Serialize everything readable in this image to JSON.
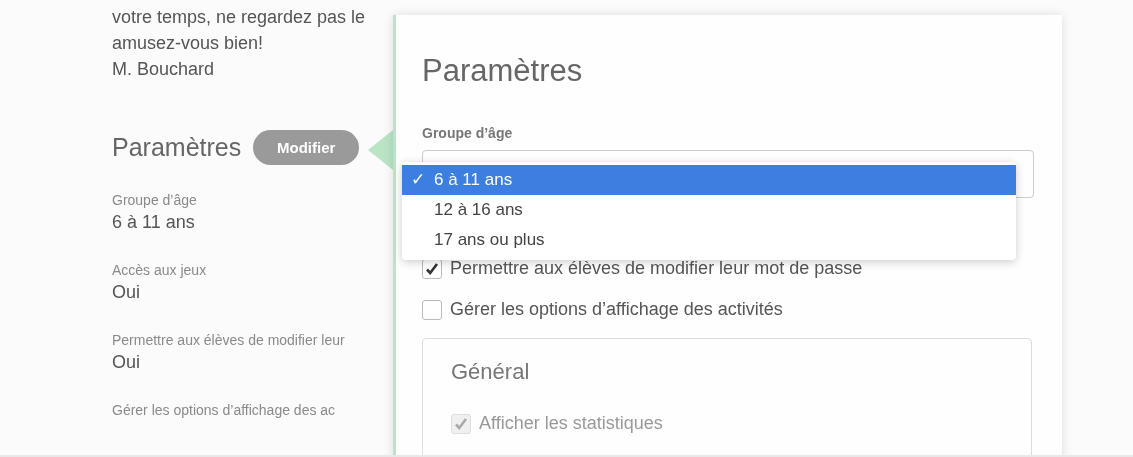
{
  "message": {
    "lines": [
      "votre temps, ne regardez pas le",
      "amusez-vous bien!",
      "M. Bouchard"
    ]
  },
  "summary": {
    "title": "Paramètres",
    "edit_button": "Modifier",
    "fields": [
      {
        "label": "Groupe d’âge",
        "value": "6 à 11 ans"
      },
      {
        "label": "Accès aux jeux",
        "value": "Oui"
      },
      {
        "label": "Permettre aux élèves de modifier leur",
        "value": "Oui"
      },
      {
        "label": "Gérer les options d’affichage des ac"
      }
    ]
  },
  "panel": {
    "title": "Paramètres",
    "age_group": {
      "label": "Groupe d’âge",
      "check": "✓",
      "options": [
        {
          "label": "6 à 11 ans",
          "selected": true
        },
        {
          "label": "12 à 16 ans",
          "selected": false
        },
        {
          "label": "17 ans ou plus",
          "selected": false
        }
      ]
    },
    "checkboxes": [
      {
        "label": "Permettre aux élèves de modifier leur mot de passe",
        "checked": true
      },
      {
        "label": "Gérer les options d’affichage des activités",
        "checked": false
      }
    ],
    "section": {
      "title": "Général",
      "checkboxes": [
        {
          "label": "Afficher les statistiques",
          "checked": true,
          "disabled": true
        }
      ]
    }
  }
}
